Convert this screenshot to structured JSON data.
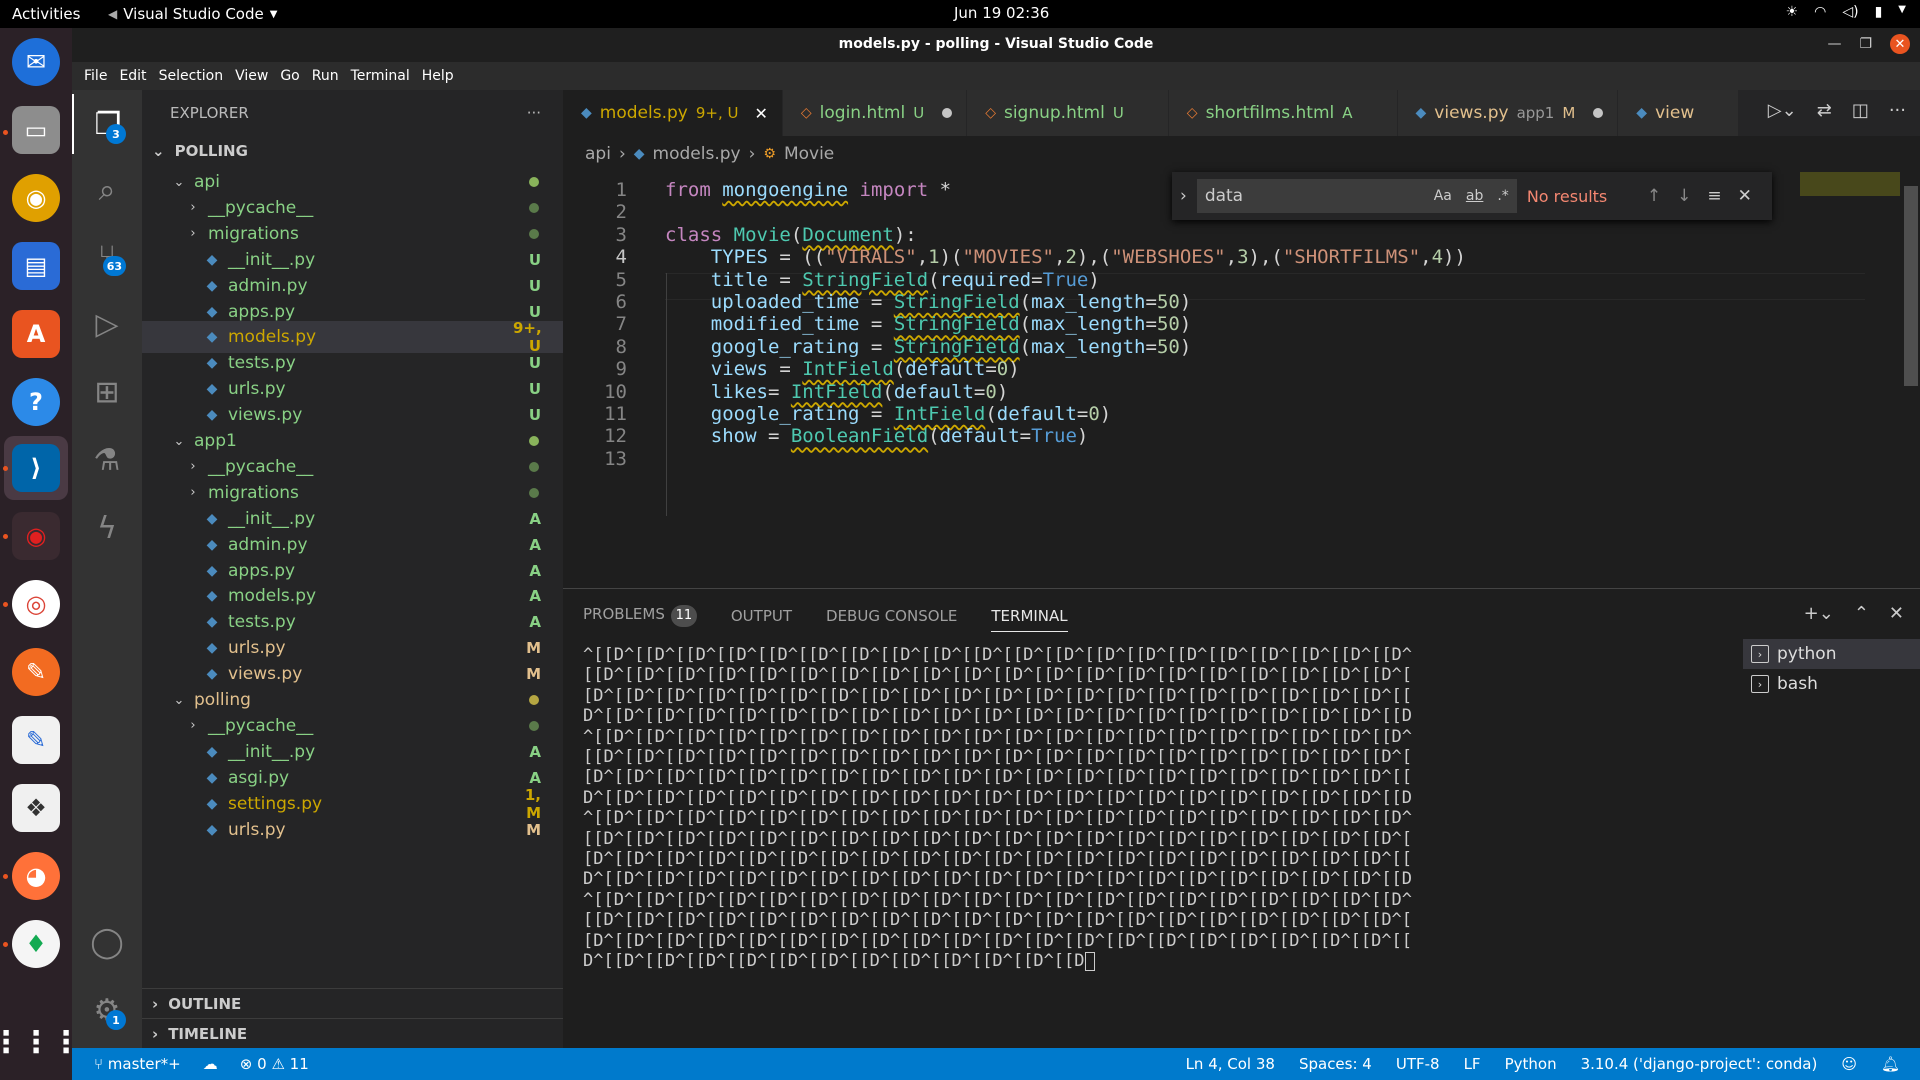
{
  "topbar": {
    "activities": "Activities",
    "app_name": "Visual Studio Code",
    "clock": "Jun 19  02:36"
  },
  "window": {
    "title": "models.py - polling - Visual Studio Code"
  },
  "menu": [
    "File",
    "Edit",
    "Selection",
    "View",
    "Go",
    "Run",
    "Terminal",
    "Help"
  ],
  "activity": {
    "explorer_badge": "3",
    "scm_badge": "63",
    "settings_badge": "1"
  },
  "explorer": {
    "title": "EXPLORER",
    "more": "···",
    "root": "POLLING",
    "items": [
      {
        "label": "api",
        "kind": "folder",
        "indent": 1,
        "open": true,
        "dot": "#89b35b",
        "color": "#89d185"
      },
      {
        "label": "__pycache__",
        "kind": "folder",
        "indent": 2,
        "open": false,
        "dot": "#5a7a4a",
        "color": "#89d185"
      },
      {
        "label": "migrations",
        "kind": "folder",
        "indent": 2,
        "open": false,
        "dot": "#5a7a4a",
        "color": "#89d185"
      },
      {
        "label": "__init__.py",
        "kind": "file",
        "indent": 2,
        "status": "U",
        "color": "#89d185"
      },
      {
        "label": "admin.py",
        "kind": "file",
        "indent": 2,
        "status": "U",
        "color": "#89d185"
      },
      {
        "label": "apps.py",
        "kind": "file",
        "indent": 2,
        "status": "U",
        "color": "#89d185"
      },
      {
        "label": "models.py",
        "kind": "file",
        "indent": 2,
        "status": "9+, U",
        "color": "#cca700",
        "selected": true
      },
      {
        "label": "tests.py",
        "kind": "file",
        "indent": 2,
        "status": "U",
        "color": "#89d185"
      },
      {
        "label": "urls.py",
        "kind": "file",
        "indent": 2,
        "status": "U",
        "color": "#89d185"
      },
      {
        "label": "views.py",
        "kind": "file",
        "indent": 2,
        "status": "U",
        "color": "#89d185"
      },
      {
        "label": "app1",
        "kind": "folder",
        "indent": 1,
        "open": true,
        "dot": "#89b35b",
        "color": "#89d185"
      },
      {
        "label": "__pycache__",
        "kind": "folder",
        "indent": 2,
        "open": false,
        "dot": "#5a7a4a",
        "color": "#89d185"
      },
      {
        "label": "migrations",
        "kind": "folder",
        "indent": 2,
        "open": false,
        "dot": "#5a7a4a",
        "color": "#89d185"
      },
      {
        "label": "__init__.py",
        "kind": "file",
        "indent": 2,
        "status": "A",
        "color": "#89d185"
      },
      {
        "label": "admin.py",
        "kind": "file",
        "indent": 2,
        "status": "A",
        "color": "#89d185"
      },
      {
        "label": "apps.py",
        "kind": "file",
        "indent": 2,
        "status": "A",
        "color": "#89d185"
      },
      {
        "label": "models.py",
        "kind": "file",
        "indent": 2,
        "status": "A",
        "color": "#89d185"
      },
      {
        "label": "tests.py",
        "kind": "file",
        "indent": 2,
        "status": "A",
        "color": "#89d185"
      },
      {
        "label": "urls.py",
        "kind": "file",
        "indent": 2,
        "status": "M",
        "color": "#e2c08d"
      },
      {
        "label": "views.py",
        "kind": "file",
        "indent": 2,
        "status": "M",
        "color": "#e2c08d"
      },
      {
        "label": "polling",
        "kind": "folder",
        "indent": 1,
        "open": true,
        "dot": "#b5a642",
        "color": "#e2c08d"
      },
      {
        "label": "__pycache__",
        "kind": "folder",
        "indent": 2,
        "open": false,
        "dot": "#5a7a4a",
        "color": "#89d185"
      },
      {
        "label": "__init__.py",
        "kind": "file",
        "indent": 2,
        "status": "A",
        "color": "#89d185"
      },
      {
        "label": "asgi.py",
        "kind": "file",
        "indent": 2,
        "status": "A",
        "color": "#89d185"
      },
      {
        "label": "settings.py",
        "kind": "file",
        "indent": 2,
        "status": "1, M",
        "color": "#cca700"
      },
      {
        "label": "urls.py",
        "kind": "file",
        "indent": 2,
        "status": "M",
        "color": "#e2c08d"
      }
    ],
    "outline": "OUTLINE",
    "timeline": "TIMELINE"
  },
  "tabs": [
    {
      "label": "models.py",
      "suffix": "9+, U",
      "icon": "python",
      "color": "#cca700",
      "active": true,
      "end": "close"
    },
    {
      "label": "login.html",
      "suffix": "U",
      "icon": "html",
      "color": "#89d185",
      "end": "dot"
    },
    {
      "label": "signup.html",
      "suffix": "U",
      "icon": "html",
      "color": "#89d185",
      "end": ""
    },
    {
      "label": "shortfilms.html",
      "suffix": "A",
      "icon": "html",
      "color": "#89d185",
      "end": ""
    },
    {
      "label": "views.py",
      "suffix": "app1",
      "suffix2": "M",
      "icon": "python",
      "color": "#e2c08d",
      "end": "dot"
    },
    {
      "label": "view",
      "suffix": "",
      "icon": "python",
      "color": "#e2c08d",
      "end": ""
    }
  ],
  "breadcrumb": [
    "api",
    "models.py",
    "Movie"
  ],
  "find": {
    "value": "data",
    "opt_case": "Aa",
    "opt_word": "ab",
    "opt_regex": ".*",
    "result": "No results"
  },
  "editor": {
    "line_numbers": [
      "1",
      "2",
      "3",
      "4",
      "5",
      "6",
      "7",
      "8",
      "9",
      "10",
      "11",
      "12",
      "13"
    ],
    "current_line": "4",
    "lines": [
      "from mongoengine import *",
      "",
      "class Movie(Document):",
      "    TYPES = ((\"VIRALS\",1)(\"MOVIES\",2),(\"WEBSHOES\",3),(\"SHORTFILMS\",4))",
      "    title = StringField(required=True)",
      "    uploaded_time = StringField(max_length=50)",
      "    modified_time = StringField(max_length=50)",
      "    google_rating = StringField(max_length=50)",
      "    views = IntField(default=0)",
      "    likes= IntField(default=0)",
      "    google_rating = IntField(default=0)",
      "    show = BooleanField(default=True)",
      ""
    ]
  },
  "panel": {
    "tabs": [
      "PROBLEMS",
      "OUTPUT",
      "DEBUG CONSOLE",
      "TERMINAL"
    ],
    "problems_count": "11",
    "active_tab": "TERMINAL",
    "terminal_lines": [
      "^[[D^[[D^[[D^[[D^[[D^[[D^[[D^[[D^[[D^[[D^[[D^[[D^[[D^[[D^[[D^[[D^[[D^[[D^[[D^[[D^",
      "[[D^[[D^[[D^[[D^[[D^[[D^[[D^[[D^[[D^[[D^[[D^[[D^[[D^[[D^[[D^[[D^[[D^[[D^[[D^[[D^[",
      "[D^[[D^[[D^[[D^[[D^[[D^[[D^[[D^[[D^[[D^[[D^[[D^[[D^[[D^[[D^[[D^[[D^[[D^[[D^[[D^[[",
      "D^[[D^[[D^[[D^[[D^[[D^[[D^[[D^[[D^[[D^[[D^[[D^[[D^[[D^[[D^[[D^[[D^[[D^[[D^[[D^[[D",
      "^[[D^[[D^[[D^[[D^[[D^[[D^[[D^[[D^[[D^[[D^[[D^[[D^[[D^[[D^[[D^[[D^[[D^[[D^[[D^[[D^",
      "[[D^[[D^[[D^[[D^[[D^[[D^[[D^[[D^[[D^[[D^[[D^[[D^[[D^[[D^[[D^[[D^[[D^[[D^[[D^[[D^[",
      "[D^[[D^[[D^[[D^[[D^[[D^[[D^[[D^[[D^[[D^[[D^[[D^[[D^[[D^[[D^[[D^[[D^[[D^[[D^[[D^[[",
      "D^[[D^[[D^[[D^[[D^[[D^[[D^[[D^[[D^[[D^[[D^[[D^[[D^[[D^[[D^[[D^[[D^[[D^[[D^[[D^[[D",
      "^[[D^[[D^[[D^[[D^[[D^[[D^[[D^[[D^[[D^[[D^[[D^[[D^[[D^[[D^[[D^[[D^[[D^[[D^[[D^[[D^",
      "[[D^[[D^[[D^[[D^[[D^[[D^[[D^[[D^[[D^[[D^[[D^[[D^[[D^[[D^[[D^[[D^[[D^[[D^[[D^[[D^[",
      "[D^[[D^[[D^[[D^[[D^[[D^[[D^[[D^[[D^[[D^[[D^[[D^[[D^[[D^[[D^[[D^[[D^[[D^[[D^[[D^[[",
      "D^[[D^[[D^[[D^[[D^[[D^[[D^[[D^[[D^[[D^[[D^[[D^[[D^[[D^[[D^[[D^[[D^[[D^[[D^[[D^[[D",
      "^[[D^[[D^[[D^[[D^[[D^[[D^[[D^[[D^[[D^[[D^[[D^[[D^[[D^[[D^[[D^[[D^[[D^[[D^[[D^[[D^",
      "[[D^[[D^[[D^[[D^[[D^[[D^[[D^[[D^[[D^[[D^[[D^[[D^[[D^[[D^[[D^[[D^[[D^[[D^[[D^[[D^[",
      "[D^[[D^[[D^[[D^[[D^[[D^[[D^[[D^[[D^[[D^[[D^[[D^[[D^[[D^[[D^[[D^[[D^[[D^[[D^[[D^[[",
      "D^[[D^[[D^[[D^[[D^[[D^[[D^[[D^[[D^[[D^[[D^[[D^[[D"
    ],
    "terminals": [
      "python",
      "bash"
    ]
  },
  "status": {
    "branch": "master*+",
    "errors": "0",
    "warnings": "11",
    "position": "Ln 4, Col 38",
    "spaces": "Spaces: 4",
    "encoding": "UTF-8",
    "eol": "LF",
    "language": "Python",
    "interpreter": "3.10.4 ('django-project': conda)"
  },
  "colors": {
    "accent": "#007acc",
    "ubuntu_orange": "#e95420"
  }
}
